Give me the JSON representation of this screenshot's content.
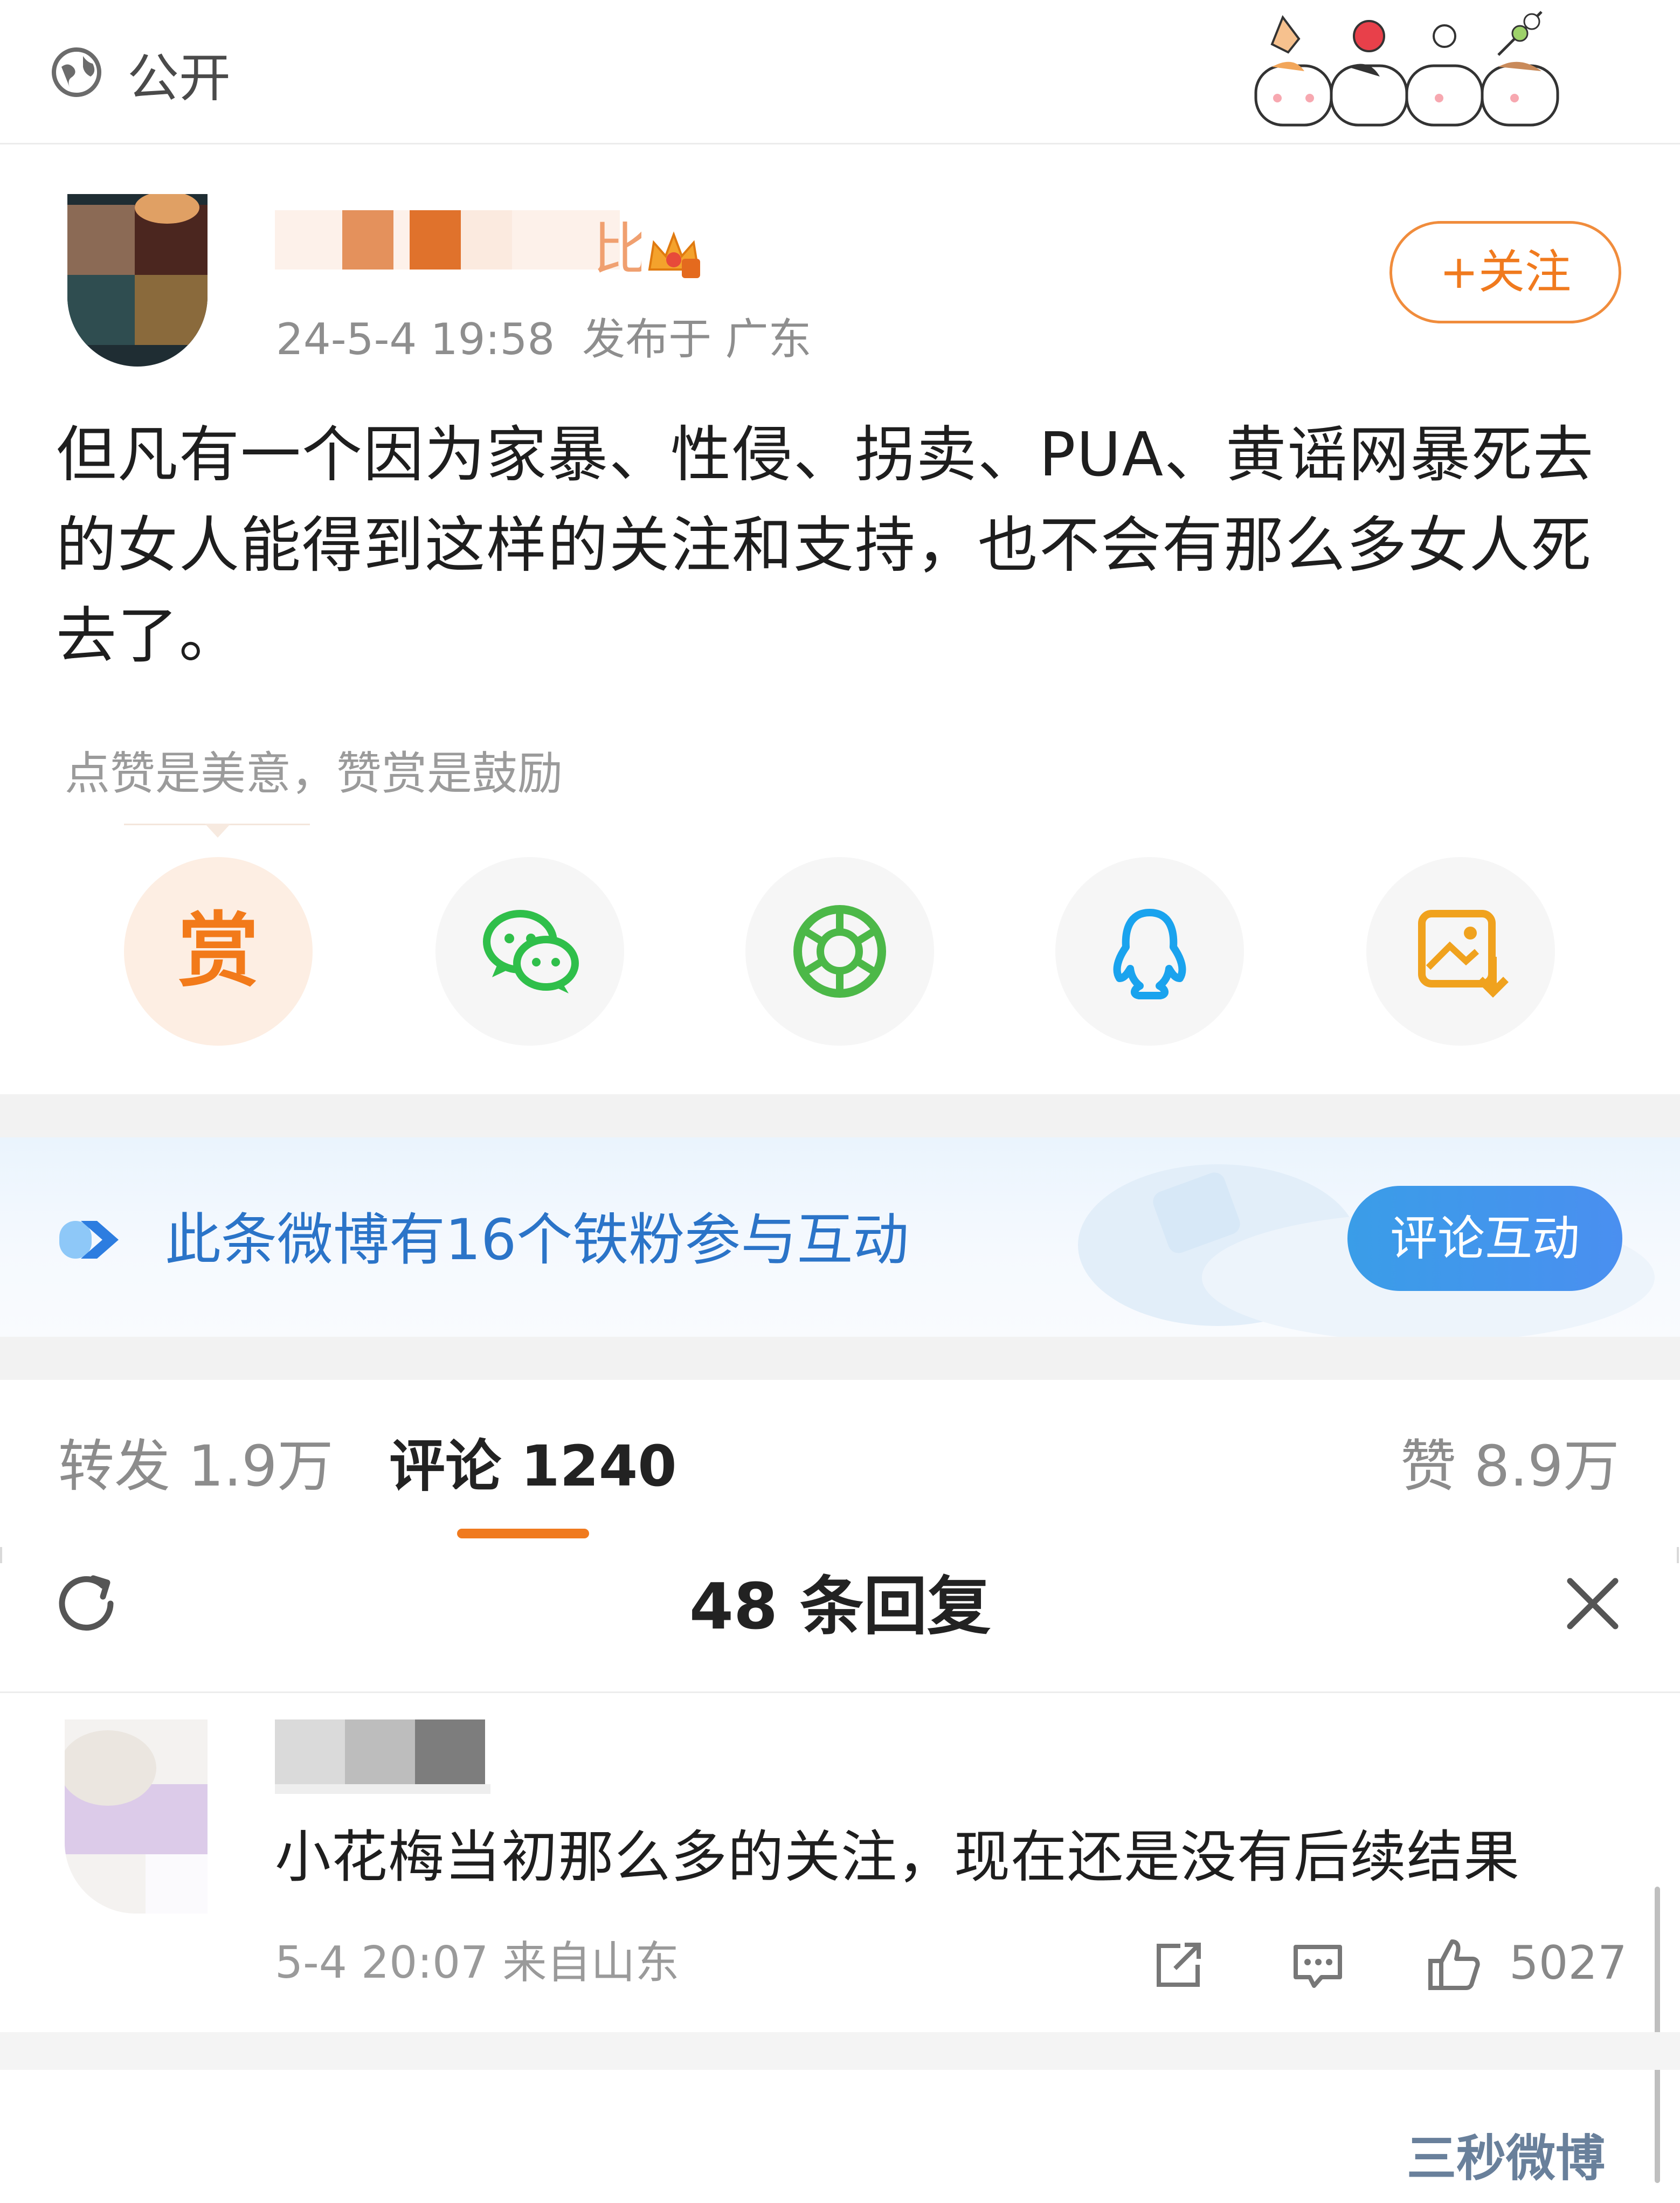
{
  "visibility": {
    "icon": "globe-icon",
    "label": "公开"
  },
  "author": {
    "name_suffix": "比",
    "badge": "crown-icon",
    "timestamp": "24-5-4 19:58",
    "location": "发布于 广东",
    "follow_label": "+关注"
  },
  "post": {
    "text": "但凡有一个因为家暴、性侵、拐卖、PUA、黄谣网暴死去的女人能得到这样的关注和支持，也不会有那么多女人死去了。"
  },
  "reward_tip": "点赞是美意，赞赏是鼓励",
  "share": {
    "reward_label": "赏",
    "items": [
      "wechat-icon",
      "moments-icon",
      "qq-icon",
      "save-image-icon"
    ]
  },
  "fan_banner": {
    "text": "此条微博有16个铁粉参与互动",
    "button": "评论互动"
  },
  "stats": {
    "repost": "转发 1.9万",
    "comment": "评论 1240",
    "like": "赞 8.9万"
  },
  "replies": {
    "title": "48 条回复",
    "comment": {
      "text": "小花梅当初那么多的关注，现在还是没有后续结果",
      "meta": "5-4 20:07  来自山东",
      "likes": "5027"
    }
  },
  "watermark": "三秒微博",
  "colors": {
    "accent": "#f07a1e",
    "link_blue": "#2b74c8",
    "button_blue": "#3a9de8"
  }
}
